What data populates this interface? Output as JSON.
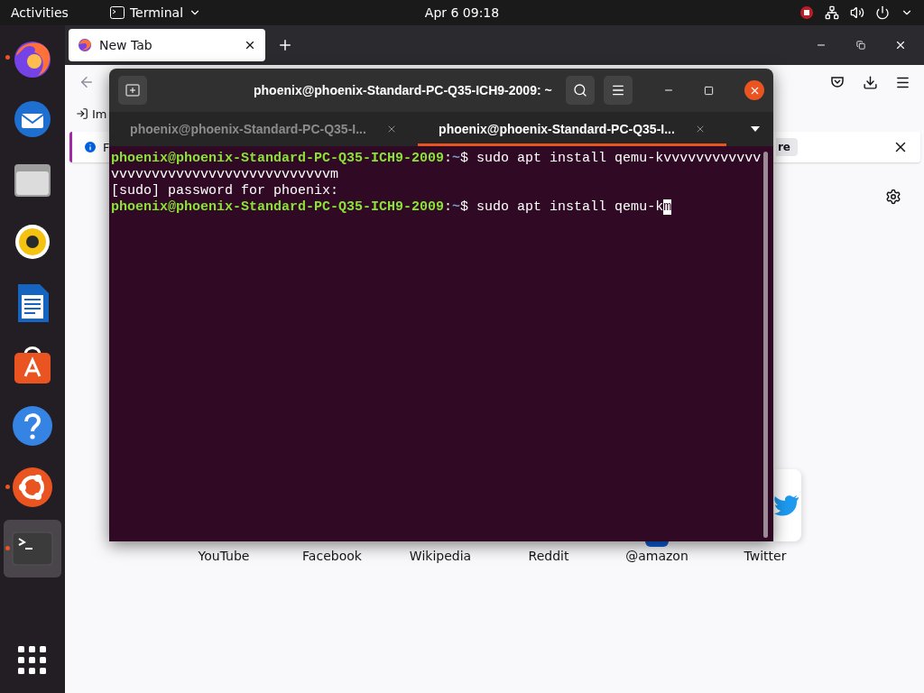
{
  "top_bar": {
    "activities": "Activities",
    "app_menu": "Terminal",
    "clock": "Apr 6  09:18"
  },
  "dock": {
    "items": [
      {
        "kind": "browser",
        "running": true,
        "selected": false
      },
      {
        "kind": "mail",
        "running": false,
        "selected": false
      },
      {
        "kind": "files",
        "running": false,
        "selected": false
      },
      {
        "kind": "music",
        "running": false,
        "selected": false
      },
      {
        "kind": "writer",
        "running": false,
        "selected": false
      },
      {
        "kind": "store",
        "running": false,
        "selected": false
      },
      {
        "kind": "help",
        "running": false,
        "selected": false
      },
      {
        "kind": "ubuntu",
        "running": true,
        "selected": false
      },
      {
        "kind": "terminal",
        "running": true,
        "selected": true
      }
    ]
  },
  "browser": {
    "tab": {
      "label": "New Tab"
    },
    "bookmark": "Im",
    "notification": {
      "text": "F",
      "button": "re"
    },
    "shortcuts": [
      {
        "label": "YouTube"
      },
      {
        "label": "Facebook"
      },
      {
        "label": "Wikipedia"
      },
      {
        "label": "Reddit"
      },
      {
        "label": "@amazon",
        "kind": "round"
      },
      {
        "label": "Twitter",
        "kind": "tile"
      }
    ]
  },
  "terminal": {
    "title": "phoenix@phoenix-Standard-PC-Q35-ICH9-2009: ~",
    "tabs": [
      {
        "label": "phoenix@phoenix-Standard-PC-Q35-I...",
        "selected": false
      },
      {
        "label": "phoenix@phoenix-Standard-PC-Q35-I...",
        "selected": true
      }
    ],
    "lines": [
      {
        "kind": "prompt",
        "user": "phoenix@phoenix-Standard-PC-Q35-ICH9-2009",
        "colon": ":",
        "path": "~",
        "command": "$ sudo apt install qemu-kvvvvvvvvvvvv"
      },
      {
        "kind": "output",
        "text": "vvvvvvvvvvvvvvvvvvvvvvvvvvvm"
      },
      {
        "kind": "output",
        "text": "[sudo] password for phoenix:"
      },
      {
        "kind": "prompt",
        "user": "phoenix@phoenix-Standard-PC-Q35-ICH9-2009",
        "colon": ":",
        "path": "~",
        "command": "$ sudo apt install qemu-k",
        "cursor": "m"
      }
    ]
  }
}
